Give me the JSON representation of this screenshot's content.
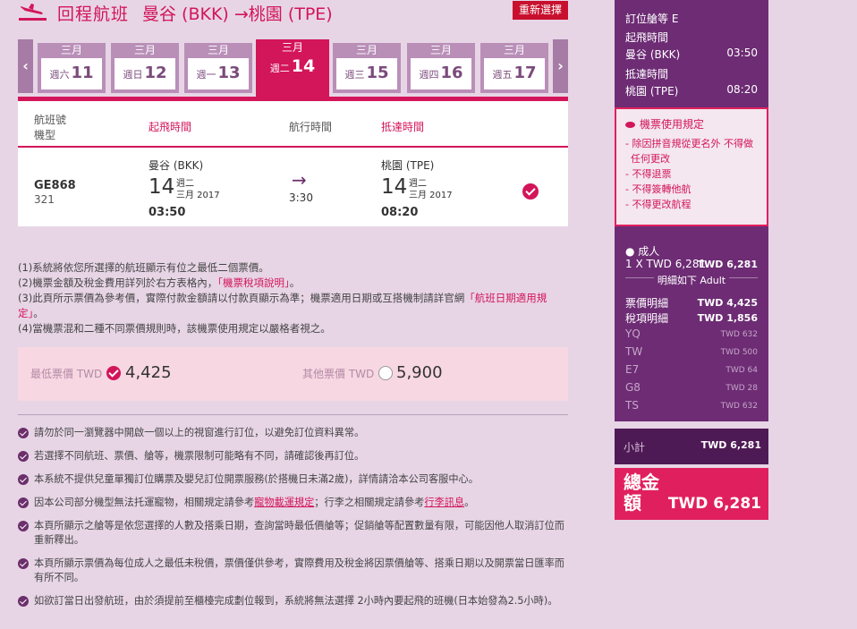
{
  "header": {
    "title": "回程航班",
    "route": "曼谷 (BKK) →桃園 (TPE)",
    "reset_button": "重新選擇"
  },
  "date_strip": {
    "prev": "‹",
    "next": "›",
    "dates": [
      {
        "month": "三月",
        "weekday": "週六",
        "day": "11"
      },
      {
        "month": "三月",
        "weekday": "週日",
        "day": "12"
      },
      {
        "month": "三月",
        "weekday": "週一",
        "day": "13"
      },
      {
        "month": "三月",
        "weekday": "週二",
        "day": "14"
      },
      {
        "month": "三月",
        "weekday": "週三",
        "day": "15"
      },
      {
        "month": "三月",
        "weekday": "週四",
        "day": "16"
      },
      {
        "month": "三月",
        "weekday": "週五",
        "day": "17"
      }
    ]
  },
  "table": {
    "h_flight": "航班號",
    "h_aircraft": "機型",
    "h_depart": "起飛時間",
    "h_duration": "航行時間",
    "h_arrive": "抵達時間",
    "flight_no": "GE868",
    "aircraft": "321",
    "dep_city": "曼谷 (BKK)",
    "dep_day": "14",
    "dep_weekday": "週二",
    "dep_monthyear": "三月 2017",
    "dep_time": "03:50",
    "arrow": "→",
    "duration": "3:30",
    "arr_city": "桃園 (TPE)",
    "arr_day": "14",
    "arr_weekday": "週二",
    "arr_monthyear": "三月 2017",
    "arr_time": "08:20"
  },
  "notes": {
    "n1": "(1)系統將依您所選擇的航班顯示有位之最低二個票價。",
    "n2a": "(2)機票金額及稅金費用詳列於右方表格內，",
    "n2b": "「機票稅項說明」",
    "n2c": "。",
    "n3a": "(3)此頁所示票價為參考價，實際付款金額請以付款頁顯示為準；機票適用日期或互搭機制請詳官網",
    "n3b": "「航班日期適用規定」",
    "n3c": "。",
    "n4": "(4)當機票混和二種不同票價規則時，該機票使用規定以嚴格者視之。"
  },
  "fares": {
    "lowest_label": "最低票價 TWD",
    "lowest_value": "4,425",
    "other_label": "其他票價 TWD",
    "other_value": "5,900"
  },
  "bullets": {
    "b1": "請勿於同一瀏覽器中開啟一個以上的視窗進行訂位，以避免訂位資料異常。",
    "b2": "若選擇不同航班、票價、艙等，機票限制可能略有不同，請確認後再訂位。",
    "b3": "本系統不提供兒童單獨訂位購票及嬰兒訂位開票服務(於搭機日未滿2歲)，詳情請洽本公司客服中心。",
    "b4a": "因本公司部分機型無法托運寵物，相關規定請參考",
    "b4b": "寵物載運規定",
    "b4c": "；行李之相關規定請參考",
    "b4d": "行李訊息",
    "b4e": "。",
    "b5": "本頁所顯示之艙等是依您選擇的人數及搭乘日期，查詢當時最低價艙等；促銷艙等配置數量有限，可能因他人取消訂位而重新釋出。",
    "b6": "本頁所顯示票價為每位成人之最低未稅價，票價僅供參考，實際費用及稅金將因票價艙等、搭乘日期以及開票當日匯率而有所不同。",
    "b7": "如欲訂當日出發航班，由於須提前至櫃檯完成劃位報到，系統將無法選擇 2小時內要起飛的班機(日本始發為2.5小時)。"
  },
  "sidebar": {
    "booking_class": "訂位艙等 E",
    "dep_label": "起飛時間",
    "dep_city": "曼谷 (BKK)",
    "dep_time": "03:50",
    "arr_label": "抵達時間",
    "arr_city": "桃園 (TPE)",
    "arr_time": "08:20",
    "rules_title": "機票使用規定",
    "rules": [
      "除因拼音規從更名外 不得做任何更改",
      "不得退票",
      "不得簽轉他航",
      "不得更改航程"
    ],
    "adult_label": "● 成人",
    "adult_calc": "1 X TWD 6,281",
    "adult_total": "TWD 6,281",
    "detail_note": "明細如下 Adult",
    "fare_detail": "票價明細",
    "fare_detail_value": "TWD 4,425",
    "tax_detail": "稅項明細",
    "tax_detail_value": "TWD 1,856",
    "taxes": [
      {
        "code": "YQ",
        "amount": "TWD 632"
      },
      {
        "code": "TW",
        "amount": "TWD 500"
      },
      {
        "code": "E7",
        "amount": "TWD 64"
      },
      {
        "code": "G8",
        "amount": "TWD 28"
      },
      {
        "code": "TS",
        "amount": "TWD 632"
      }
    ],
    "subtotal_label": "小計",
    "subtotal_value": "TWD 6,281",
    "total_label": "總金額",
    "total_value": "TWD 6,281"
  }
}
